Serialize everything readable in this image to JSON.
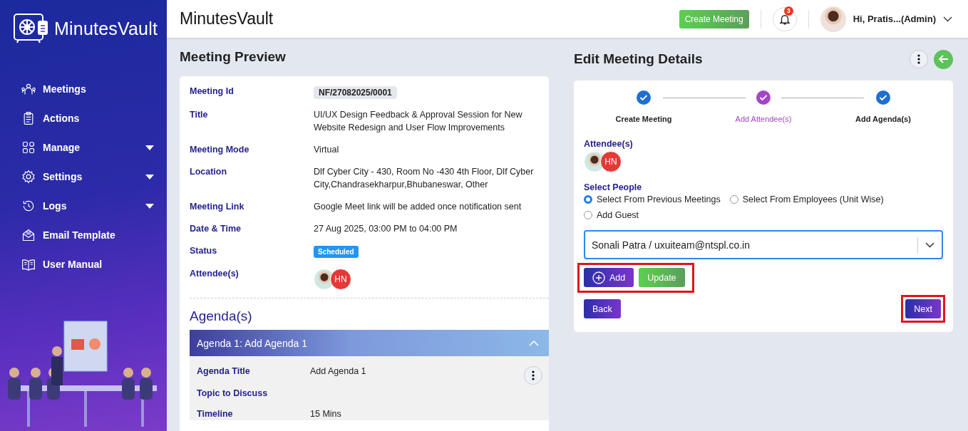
{
  "sidebar": {
    "logo": "MinutesVault",
    "items": [
      {
        "label": "Meetings",
        "has_caret": false
      },
      {
        "label": "Actions",
        "has_caret": false
      },
      {
        "label": "Manage",
        "has_caret": true
      },
      {
        "label": "Settings",
        "has_caret": true
      },
      {
        "label": "Logs",
        "has_caret": true
      },
      {
        "label": "Email Template",
        "has_caret": false
      },
      {
        "label": "User Manual",
        "has_caret": false
      }
    ]
  },
  "header": {
    "title": "MinutesVault",
    "create_button": "Create Meeting",
    "notification_count": "3",
    "user": "Hi, Pratis...(Admin)"
  },
  "preview": {
    "heading": "Meeting Preview",
    "fields": [
      {
        "label": "Meeting Id",
        "kind": "chip",
        "value": "NF/27082025/0001"
      },
      {
        "label": "Title",
        "kind": "text",
        "value": "UI/UX Design Feedback & Approval Session for New Website Redesign and User Flow Improvements"
      },
      {
        "label": "Meeting Mode",
        "kind": "text",
        "value": "Virtual"
      },
      {
        "label": "Location",
        "kind": "text",
        "value": "Dlf Cyber City - 430, Room No -430 4th Floor, Dlf Cyber City,Chandrasekharpur,Bhubaneswar, Other"
      },
      {
        "label": "Meeting Link",
        "kind": "text",
        "value": "Google Meet link will be added once notification sent"
      },
      {
        "label": "Date & Time",
        "kind": "text",
        "value": "27 Aug 2025, 03:00 PM to 04:00 PM"
      },
      {
        "label": "Status",
        "kind": "status",
        "value": "Scheduled"
      },
      {
        "label": "Attendee(s)",
        "kind": "attendees",
        "attendees": [
          {
            "kind": "photo"
          },
          {
            "kind": "initials",
            "initials": "HN"
          }
        ]
      }
    ],
    "agenda_heading": "Agenda(s)",
    "agenda": {
      "title": "Agenda 1: Add Agenda 1",
      "expanded": true,
      "fields": [
        {
          "label": "Agenda Title",
          "value": "Add Agenda 1"
        },
        {
          "label": "Topic to Discuss"
        },
        {
          "label": "Timeline",
          "value": "15 Mins"
        }
      ]
    }
  },
  "editor": {
    "heading": "Edit Meeting Details",
    "steps": [
      {
        "label": "Create Meeting",
        "selected": false
      },
      {
        "label": "Add Attendee(s)",
        "selected": true
      },
      {
        "label": "Add Agenda(s)",
        "selected": false
      }
    ],
    "attendees_label": "Attendee(s)",
    "attendees": [
      {
        "kind": "photo"
      },
      {
        "kind": "initials",
        "initials": "HN"
      }
    ],
    "select_label": "Select People",
    "options": [
      {
        "label": "Select From Previous Meetings",
        "selected": true
      },
      {
        "label": "Select From Employees (Unit Wise)",
        "selected": false
      },
      {
        "label": "Add Guest",
        "selected": false
      }
    ],
    "person": "Sonali Patra / uxuiteam@ntspl.co.in",
    "add_button": "Add",
    "update_button": "Update",
    "back_button": "Back",
    "next_button": "Next"
  }
}
